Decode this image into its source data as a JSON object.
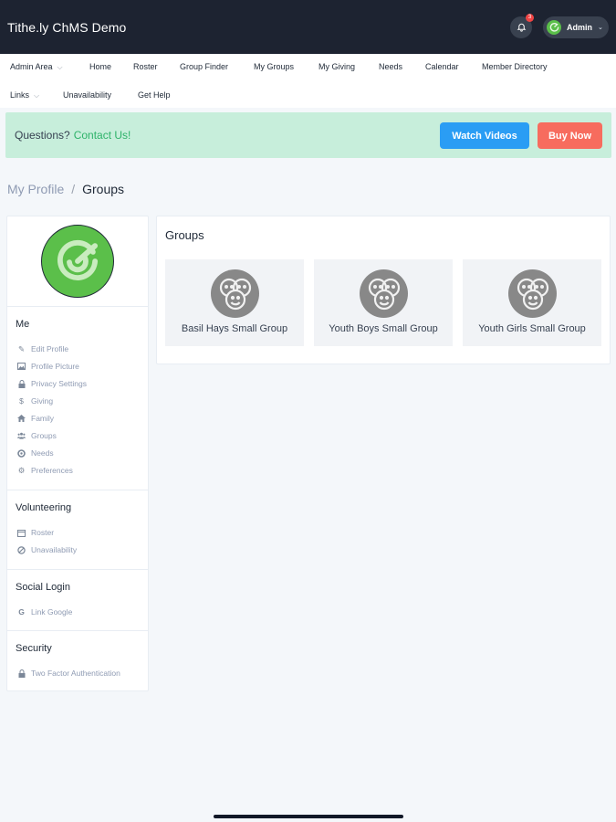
{
  "app": {
    "title": "Tithe.ly ChMS Demo",
    "notification_count": "3",
    "user_label": "Admin"
  },
  "nav": {
    "row1": [
      {
        "label": "Admin Area",
        "has_dropdown": true
      },
      {
        "label": "Home"
      },
      {
        "label": "Roster"
      },
      {
        "label": "Group Finder"
      },
      {
        "label": "My Groups"
      },
      {
        "label": "My Giving"
      },
      {
        "label": "Needs"
      },
      {
        "label": "Calendar"
      },
      {
        "label": "Member Directory"
      }
    ],
    "row2": [
      {
        "label": "Links",
        "has_dropdown": true
      },
      {
        "label": "Unavailability"
      },
      {
        "label": "Get Help"
      }
    ]
  },
  "banner": {
    "text": "Questions?",
    "link": "Contact Us!",
    "watch_videos": "Watch Videos",
    "buy_now": "Buy Now"
  },
  "breadcrumb": {
    "parent": "My Profile",
    "separator": "/",
    "current": "Groups"
  },
  "sidebar": {
    "me": {
      "heading": "Me",
      "items": [
        {
          "label": "Edit Profile",
          "icon": "pencil-icon"
        },
        {
          "label": "Profile Picture",
          "icon": "image-icon"
        },
        {
          "label": "Privacy Settings",
          "icon": "lock-icon"
        },
        {
          "label": "Giving",
          "icon": "dollar-icon"
        },
        {
          "label": "Family",
          "icon": "home-icon"
        },
        {
          "label": "Groups",
          "icon": "users-icon"
        },
        {
          "label": "Needs",
          "icon": "life-ring-icon"
        },
        {
          "label": "Preferences",
          "icon": "gear-icon"
        }
      ]
    },
    "volunteering": {
      "heading": "Volunteering",
      "items": [
        {
          "label": "Roster",
          "icon": "calendar-icon"
        },
        {
          "label": "Unavailability",
          "icon": "ban-icon"
        }
      ]
    },
    "social": {
      "heading": "Social Login",
      "items": [
        {
          "label": "Link Google",
          "icon": "google-icon"
        }
      ]
    },
    "security": {
      "heading": "Security",
      "items": [
        {
          "label": "Two Factor Authentication",
          "icon": "lock-icon"
        }
      ]
    }
  },
  "groups": {
    "title": "Groups",
    "cards": [
      {
        "name": "Basil Hays Small Group"
      },
      {
        "name": "Youth Boys Small Group"
      },
      {
        "name": "Youth Girls Small Group"
      }
    ]
  },
  "colors": {
    "topbar": "#1d2331",
    "banner": "#c7eedb",
    "accent_green": "#5bbf4a",
    "button_blue": "#2a9df4",
    "button_red": "#f76c5e"
  }
}
